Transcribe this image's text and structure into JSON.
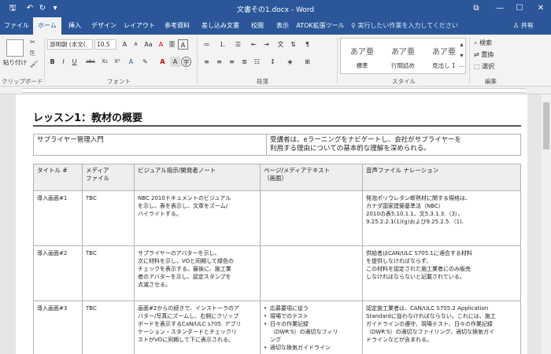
{
  "titlebar": {
    "title": "文書その1.docx - Word",
    "qa": {
      "save": "🖫",
      "undo": "↶",
      "redo": "↻",
      "customize": "▾"
    },
    "controls": {
      "options": "⧉",
      "minimize": "—",
      "maximize": "☐",
      "close": "✕"
    }
  },
  "tabs": [
    "ファイル",
    "ホーム",
    "挿入",
    "デザイン",
    "レイアウト",
    "参考資料",
    "差し込み文書",
    "校閲",
    "表示",
    "ATOK拡張ツール"
  ],
  "tell_me": "♀ 実行したい作業を入力してください",
  "share": "♙ 共有",
  "ribbon": {
    "clipboard": {
      "paste": "貼り付け",
      "label": "クリップボード"
    },
    "font": {
      "name": "游明朝 (本文(",
      "size": "10.5",
      "label": "フォント",
      "buttons": {
        "bold": "B",
        "italic": "I",
        "underline": "U",
        "strike": "abc",
        "sub": "X₂",
        "sup": "X²",
        "grow": "A",
        "shrink": "A",
        "aa": "Aa",
        "clear": "A",
        "phonetic": "亜",
        "charborder": "A"
      }
    },
    "paragraph": {
      "label": "段落"
    },
    "styles": {
      "label": "スタイル",
      "items": [
        {
          "sample": "あア亜",
          "name": "標準"
        },
        {
          "sample": "あア亜",
          "name": "行間詰め"
        },
        {
          "sample": "あア亜",
          "name": "見出し 1"
        }
      ]
    },
    "editing": {
      "find": "検索",
      "replace": "置換",
      "select": "選択",
      "label": "編集"
    }
  },
  "document": {
    "heading": "レッスン1：教材の概要",
    "intro": {
      "left": "サプライヤー管理入門",
      "right": [
        "受講者は、eラーニングをナビゲートし、会社がサプライヤーを",
        "利用する理由についての基本的な理解を深められる。"
      ]
    },
    "table": {
      "headers": [
        [
          "タイトル #"
        ],
        [
          "メディア",
          "ファイル"
        ],
        [
          "ビジュアル指示/開発者ノート"
        ],
        [
          "ページ/メディアテキスト",
          "（画面）"
        ],
        [
          "音声ファイル ナレーション"
        ]
      ],
      "rows": [
        {
          "title": "導入画面#1",
          "media": "TBC",
          "visual": [
            "NBC 2010ドキュメントのビジュアル",
            "を示し、表を表示し、文章をズーム/",
            "ハイライトする。"
          ],
          "page": [],
          "audio": [
            "発泡ポリウレタン断熱材に関する規格は、",
            "カナダ国家建築基準法（NBC）",
            "2010の表5.10.1.1、文5.3.1.3.（3）、",
            "9.25.2.2.1(1)(g)および9.25.2.5.（1)."
          ]
        },
        {
          "title": "導入画面#2",
          "media": "TBC",
          "visual": [
            "サプライヤーのアバターを示し、",
            "次に材料を示し、VOと同期して緑色の",
            "チェックを表示する。最後に、施工業",
            "者のアバターを示し、認定スタンプを",
            "点滅させる。"
          ],
          "page": [],
          "audio": [
            "供給者はCAN/ULC S705.1に適合する材料",
            "を提供しなければならず、",
            "この材料を認定された施工業者にのみ販売",
            "しなければならないと記載されている。"
          ]
        },
        {
          "title": "導入画面#3",
          "media": "TBC",
          "visual": [
            "画面#2からの続きで、インストーラのア",
            "バター/写真にズームし、右側にクリップ",
            "ボードを表示するCaN/ULC s705. アプリ",
            "ケーション・スタンダードとチェックリ",
            "ストがVOに同期して下に表示される。"
          ],
          "page": [
            "応募要項に従う",
            "現場でのテスト",
            "日々の作業記録",
            "（DWR'S）の適切なフィリ",
            "ング",
            "適切な換気ガイドライン"
          ],
          "audio": [
            "認定施工業者は、CAN/ULC S705.2 Application",
            "Standardに従わなければならない。これには、施工",
            "ガイドラインの遵守、現場テスト、日々の作業記録",
            "（DWR'S）の適切なファイリング、適切な換気ガイ",
            "ドラインなどが含まれる。"
          ]
        }
      ]
    }
  },
  "colors": {
    "accent": "#2b579a"
  }
}
